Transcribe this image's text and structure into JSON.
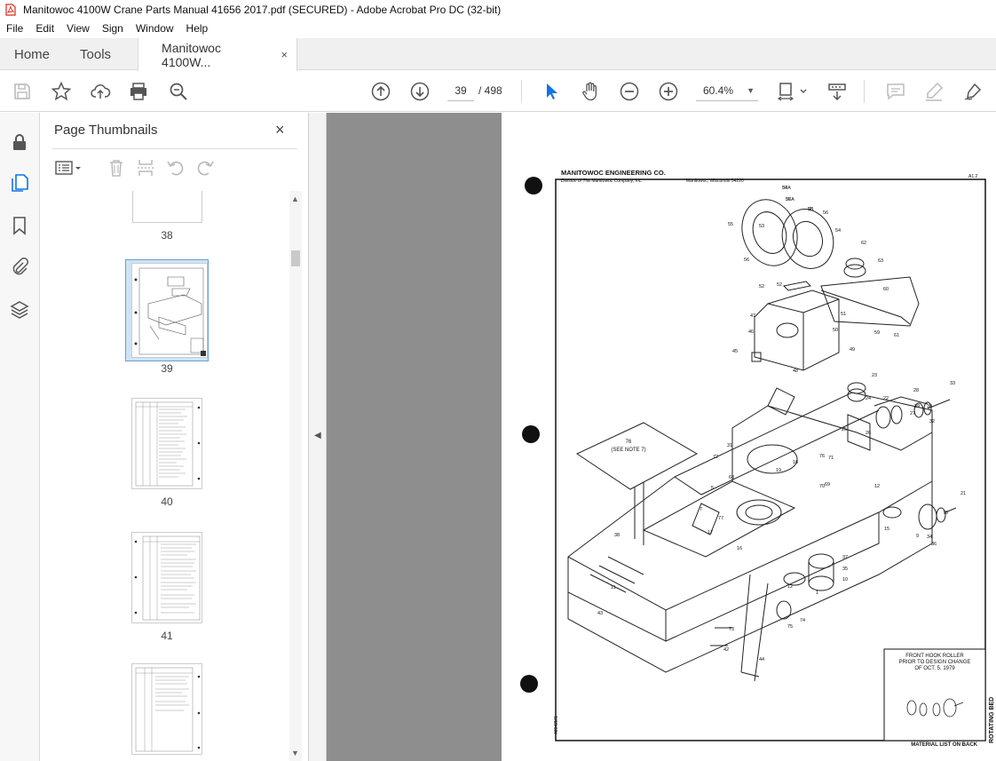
{
  "window": {
    "title": "Manitowoc 4100W Crane Parts Manual 41656 2017.pdf (SECURED) - Adobe Acrobat Pro DC (32-bit)"
  },
  "menu": [
    "File",
    "Edit",
    "View",
    "Sign",
    "Window",
    "Help"
  ],
  "tabs": {
    "home": "Home",
    "tools": "Tools",
    "document": "Manitowoc 4100W...",
    "close": "×"
  },
  "toolbar": {
    "current_page": "39",
    "page_total": "/  498",
    "zoom": "60.4%",
    "zoom_caret": "▼"
  },
  "thumbnails_panel": {
    "title": "Page Thumbnails",
    "close": "×",
    "pages": [
      {
        "label": "38"
      },
      {
        "label": "39",
        "selected": true
      },
      {
        "label": "40"
      },
      {
        "label": "41"
      }
    ]
  },
  "scrollbar": {
    "up": "▲",
    "down": "▼"
  },
  "collapse_arrow": "◀",
  "document_page": {
    "company": "MANITOWOC ENGINEERING CO.",
    "division": "Division of The Manitowoc Company, Inc.",
    "location": "Manitowoc, Wisconsin 54220",
    "sheet_ref": "A1.2",
    "note_box": "76\n(SEE NOTE 7)",
    "inset_title_1": "FRONT HOOK ROLLER",
    "inset_title_2": "PRIOR TO DESIGN CHANGE",
    "inset_title_3": "OF OCT. 5, 1979",
    "material_list": "MATERIAL LIST ON BACK",
    "side_label": "ROTATING BED",
    "drawing_number": "48942M1",
    "part_callouts": [
      "54",
      "57",
      "58",
      "56",
      "55",
      "53",
      "56",
      "54",
      "62",
      "63",
      "60",
      "59",
      "61",
      "52",
      "52",
      "47",
      "51",
      "46",
      "50",
      "45",
      "49",
      "48",
      "23",
      "33",
      "28",
      "24",
      "22",
      "25",
      "26",
      "27",
      "29",
      "30",
      "32",
      "31",
      "72",
      "71",
      "76",
      "5",
      "68",
      "18",
      "19",
      "70",
      "69",
      "12",
      "7",
      "77",
      "17",
      "16",
      "15",
      "21",
      "78",
      "9",
      "34",
      "36",
      "38",
      "37",
      "35",
      "10",
      "11",
      "12",
      "1",
      "74",
      "75",
      "73",
      "42",
      "44",
      "43",
      "41",
      "2",
      "34",
      "40",
      "38A",
      "37A",
      "36A",
      "35"
    ]
  }
}
